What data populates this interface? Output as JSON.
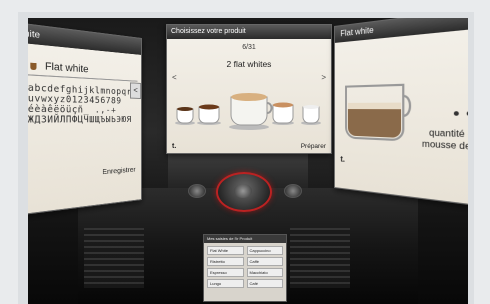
{
  "left_panel": {
    "title": "hite",
    "selected_item": "Flat white",
    "keyboard_rows": [
      "abcdefghijklmnopqr",
      "uvwxyz0123456789",
      "éèàêëöüçñ_ .,-+",
      "ЖДЗИЙЛПФЦЧШЩЪЫЬЭЮЯ"
    ],
    "save_label": "Enregistrer",
    "nav_arrow": "<"
  },
  "center_panel": {
    "title": "Choisissez votre produit",
    "counter": "6/31",
    "product_name": "2 flat whites",
    "prev": "<",
    "next": ">",
    "prepare_label": "Préparer",
    "logo": "t."
  },
  "right_panel": {
    "title": "Flat white",
    "quantity_label": [
      "quantité de",
      "mousse de lait"
    ],
    "level_dots": "● ● ● ●",
    "logo": "t."
  },
  "small_screen": {
    "title": "Mes saisies de l'ir Produit",
    "items": [
      "Flat White",
      "Cappuccino",
      "Ristretto",
      "Caffè",
      "Espresso",
      "Macchiato",
      "Lungo",
      "Café"
    ]
  },
  "colors": {
    "accent_ring": "#b22222",
    "panel_bg": "#f1ede5"
  }
}
